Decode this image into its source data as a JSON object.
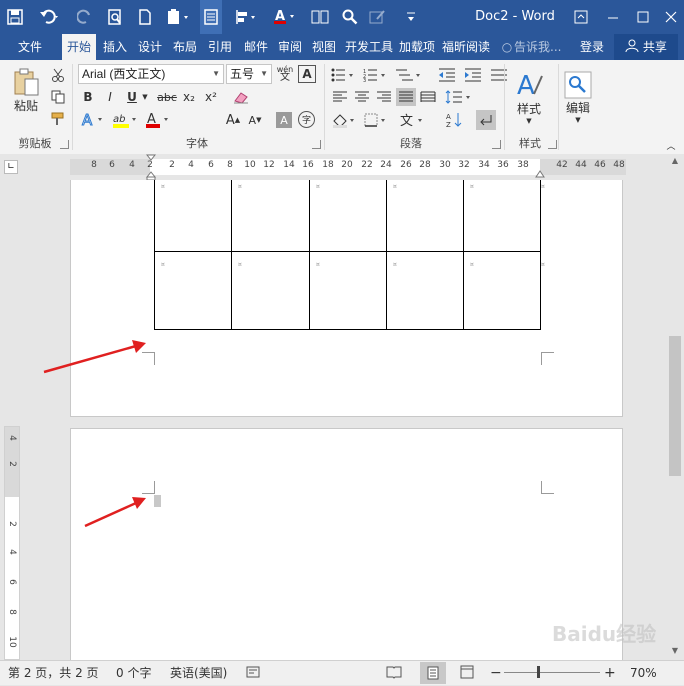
{
  "window": {
    "title": "Doc2 - Word"
  },
  "tabs": {
    "file": "文件",
    "home": "开始",
    "insert": "插入",
    "design": "设计",
    "layout": "布局",
    "references": "引用",
    "mailings": "邮件",
    "review": "审阅",
    "view": "视图",
    "developer": "开发工具",
    "addins": "加载项",
    "foxit": "福昕阅读",
    "tell_me": "告诉我...",
    "signin": "登录",
    "share": "共享"
  },
  "ribbon": {
    "paste_label": "粘贴",
    "font_name": "Arial (西文正文)",
    "font_size": "五号",
    "wen_glyph": "wén",
    "styles_label": "样式",
    "editing_label": "编辑",
    "groups": {
      "clipboard": "剪贴板",
      "font": "字体",
      "paragraph": "段落",
      "styles": "样式"
    },
    "bold": "B",
    "italic": "I",
    "underline": "U",
    "strike": "abc",
    "sub": "x₂",
    "sup": "x²",
    "font_color_glyph": "A",
    "highlight_glyph": "ab",
    "char_shade_glyph": "A",
    "enclose_glyph": "字",
    "grow_glyph": "A",
    "shrink_glyph": "A",
    "text_effects_glyph": "A",
    "char_border_glyph": "A"
  },
  "ruler": {
    "ticks_left": [
      "8",
      "6",
      "4",
      "2"
    ],
    "ticks_right": [
      "2",
      "4",
      "6",
      "8",
      "10",
      "12",
      "14",
      "16",
      "18",
      "20",
      "22",
      "24",
      "26",
      "28",
      "30",
      "32",
      "34",
      "36",
      "38",
      "42",
      "44",
      "46",
      "48"
    ],
    "vticks": [
      "4",
      "2",
      "2",
      "4",
      "6",
      "8",
      "10"
    ]
  },
  "status": {
    "page": "第 2 页，共 2 页",
    "words": "0 个字",
    "language": "英语(美国)",
    "zoom": "70%"
  },
  "watermark": "Baidu经验",
  "colors": {
    "accent": "#2b579a",
    "arrow": "#e02020",
    "font_color": "#e00000",
    "highlight": "#ffff00"
  }
}
